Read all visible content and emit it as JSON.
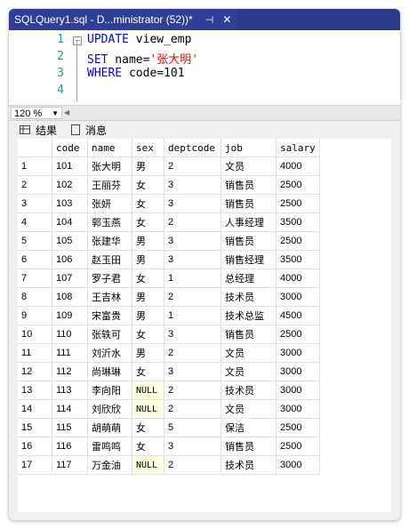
{
  "tab": {
    "title": "SQLQuery1.sql - D...ministrator (52))*",
    "pin": "⊣",
    "close": "✕"
  },
  "editor": {
    "line_numbers": [
      "1",
      "2",
      "3",
      "4"
    ],
    "lines": [
      {
        "kw": "UPDATE",
        "rest": " view_emp"
      },
      {
        "kw": "SET",
        "rest": " name=",
        "str": "'张大明'"
      },
      {
        "kw": "WHERE",
        "rest": " code=101"
      },
      {
        "kw": "",
        "rest": ""
      }
    ]
  },
  "zoom": {
    "value": "120 %"
  },
  "result_tabs": {
    "results": "结果",
    "messages": "消息"
  },
  "table": {
    "columns": [
      "code",
      "name",
      "sex",
      "deptcode",
      "job",
      "salary"
    ],
    "rows": [
      [
        "1",
        "101",
        "张大明",
        "男",
        "2",
        "文员",
        "4000"
      ],
      [
        "2",
        "102",
        "王丽芬",
        "女",
        "3",
        "销售员",
        "2500"
      ],
      [
        "3",
        "103",
        "张妍",
        "女",
        "3",
        "销售员",
        "2500"
      ],
      [
        "4",
        "104",
        "郭玉燕",
        "女",
        "2",
        "人事经理",
        "3500"
      ],
      [
        "5",
        "105",
        "张建华",
        "男",
        "3",
        "销售员",
        "2500"
      ],
      [
        "6",
        "106",
        "赵玉田",
        "男",
        "3",
        "销售经理",
        "3500"
      ],
      [
        "7",
        "107",
        "罗子君",
        "女",
        "1",
        "总经理",
        "4000"
      ],
      [
        "8",
        "108",
        "王吉林",
        "男",
        "2",
        "技术员",
        "3000"
      ],
      [
        "9",
        "109",
        "宋富贵",
        "男",
        "1",
        "技术总监",
        "4500"
      ],
      [
        "10",
        "110",
        "张轶可",
        "女",
        "3",
        "销售员",
        "2500"
      ],
      [
        "11",
        "111",
        "刘沂水",
        "男",
        "2",
        "文员",
        "3000"
      ],
      [
        "12",
        "112",
        "尚琳琳",
        "女",
        "3",
        "文员",
        "3000"
      ],
      [
        "13",
        "113",
        "李向阳",
        "NULL",
        "2",
        "技术员",
        "3000"
      ],
      [
        "14",
        "114",
        "刘欣欣",
        "NULL",
        "2",
        "文员",
        "3000"
      ],
      [
        "15",
        "115",
        "胡萌萌",
        "女",
        "5",
        "保洁",
        "2500"
      ],
      [
        "16",
        "116",
        "雷鸣鸣",
        "女",
        "3",
        "销售员",
        "2500"
      ],
      [
        "17",
        "117",
        "万金油",
        "NULL",
        "2",
        "技术员",
        "3000"
      ]
    ]
  },
  "colors": {
    "tab_bg": "#2b3b8a",
    "keyword": "#0000ff",
    "string": "#ff0000",
    "line_number": "#2b91af",
    "null_bg": "#ffffe1"
  }
}
